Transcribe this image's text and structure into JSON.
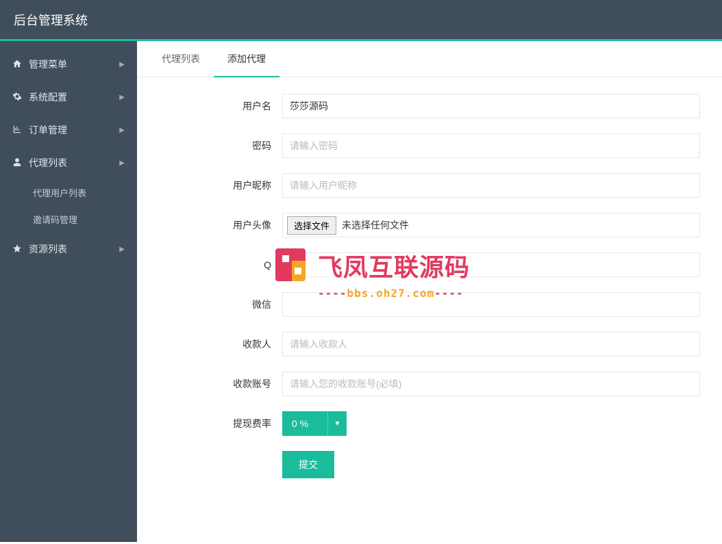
{
  "header": {
    "title": "后台管理系统"
  },
  "sidebar": {
    "items": [
      {
        "icon": "home",
        "label": "管理菜单",
        "expandable": true
      },
      {
        "icon": "gears",
        "label": "系统配置",
        "expandable": true
      },
      {
        "icon": "chart",
        "label": "订单管理",
        "expandable": true
      },
      {
        "icon": "user",
        "label": "代理列表",
        "expandable": true
      },
      {
        "icon": "star",
        "label": "资源列表",
        "expandable": true
      }
    ],
    "subitems": [
      {
        "label": "代理用户列表"
      },
      {
        "label": "邀请码管理"
      }
    ]
  },
  "tabs": [
    {
      "label": "代理列表",
      "active": false
    },
    {
      "label": "添加代理",
      "active": true
    }
  ],
  "form": {
    "username": {
      "label": "用户名",
      "value": "莎莎源码"
    },
    "password": {
      "label": "密码",
      "placeholder": "请输入密码"
    },
    "nickname": {
      "label": "用户昵称",
      "placeholder": "请输入用户昵称"
    },
    "avatar": {
      "label": "用户头像",
      "button": "选择文件",
      "status": "未选择任何文件"
    },
    "qq": {
      "label": "Q"
    },
    "wechat": {
      "label": "微信"
    },
    "payee": {
      "label": "收款人",
      "placeholder": "请输入收款人"
    },
    "account": {
      "label": "收款账号",
      "placeholder": "请输入您的收款账号(必填)"
    },
    "rate": {
      "label": "提现费率",
      "value": "0 %"
    },
    "submit": {
      "label": "提交"
    }
  },
  "watermark": {
    "text": "飞凤互联源码",
    "sub_dashes": "----",
    "sub_url": "bbs.oh27.com"
  }
}
